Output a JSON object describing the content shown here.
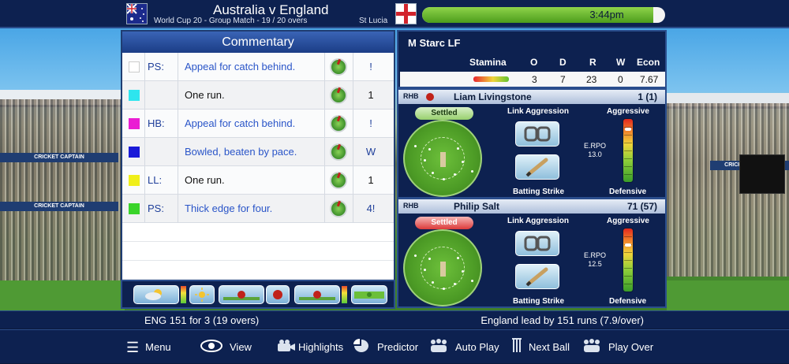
{
  "header": {
    "match_title": "Australia v England",
    "match_subtitle": "World Cup 20 - Group Match - 19 / 20 overs",
    "venue": "St Lucia",
    "time": "3:44pm",
    "day_progress": 0.95
  },
  "commentary": {
    "title": "Commentary",
    "rows": [
      {
        "color": "#ffffff",
        "abbr": "PS:",
        "text": "Appeal for catch behind.",
        "runs": "!",
        "highlight": true
      },
      {
        "color": "#2ee5ee",
        "abbr": "",
        "text": "One run.",
        "runs": "1",
        "highlight": false
      },
      {
        "color": "#ea1dd3",
        "abbr": "HB:",
        "text": "Appeal for catch behind.",
        "runs": "!",
        "highlight": true
      },
      {
        "color": "#1a1ad8",
        "abbr": "",
        "text": "Bowled, beaten by pace.",
        "runs": "W",
        "highlight": true
      },
      {
        "color": "#f0ef1a",
        "abbr": "LL:",
        "text": "One run.",
        "runs": "1",
        "highlight": false
      },
      {
        "color": "#3ad42a",
        "abbr": "PS:",
        "text": "Thick edge for four.",
        "runs": "4!",
        "highlight": true
      }
    ]
  },
  "bowler": {
    "name": "M Starc LF",
    "headers": [
      "Stamina",
      "O",
      "D",
      "R",
      "W",
      "Econ"
    ],
    "overs": "3",
    "dots": "7",
    "runs": "23",
    "wickets": "0",
    "econ": "7.67",
    "stamina": 0.9
  },
  "batsmen": [
    {
      "hand": "RHB",
      "name": "Liam Livingstone",
      "score": "1 (1)",
      "status": "Settled",
      "on_strike": true,
      "link_label": "Link Aggression",
      "strike_label": "Batting Strike",
      "aggressive_label": "Aggressive",
      "defensive_label": "Defensive",
      "erpo_label": "E.RPO",
      "erpo_value": "13.0",
      "aggression_level": 0.85
    },
    {
      "hand": "RHB",
      "name": "Philip Salt",
      "score": "71 (57)",
      "status": "Settled",
      "on_strike": false,
      "link_label": "Link Aggression",
      "strike_label": "Batting Strike",
      "aggressive_label": "Aggressive",
      "defensive_label": "Defensive",
      "erpo_label": "E.RPO",
      "erpo_value": "12.5",
      "aggression_level": 0.75
    }
  ],
  "status_bar": {
    "left": "ENG  151 for 3  (19 overs)",
    "right": "England lead by 151 runs (7.9/over)"
  },
  "menu": [
    {
      "label": "Menu",
      "icon": "hamburger-icon"
    },
    {
      "label": "View",
      "icon": "eye-icon"
    },
    {
      "label": "Highlights",
      "icon": "camera-icon"
    },
    {
      "label": "Predictor",
      "icon": "pie-chart-icon"
    },
    {
      "label": "Auto Play",
      "icon": "fielders-icon"
    },
    {
      "label": "Next Ball",
      "icon": "stumps-icon"
    },
    {
      "label": "Play Over",
      "icon": "fielders-icon"
    }
  ],
  "colors": {
    "navy": "#0d2150",
    "accent": "#2a55c8",
    "green": "#4d9d1c"
  }
}
